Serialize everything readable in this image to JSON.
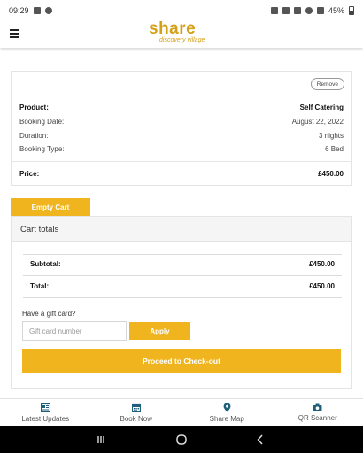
{
  "status_bar": {
    "time": "09:29",
    "battery": "45%"
  },
  "app": {
    "logo_main": "share",
    "logo_sub": "discovery village"
  },
  "cart_item": {
    "remove_label": "Remove",
    "rows": [
      {
        "label": "Product:",
        "value": "Self Catering"
      },
      {
        "label": "Booking Date:",
        "value": "August 22, 2022"
      },
      {
        "label": "Duration:",
        "value": "3 nights"
      },
      {
        "label": "Booking Type:",
        "value": "6 Bed"
      }
    ],
    "price_label": "Price:",
    "price_value": "£450.00"
  },
  "empty_cart_label": "Empty Cart",
  "totals": {
    "title": "Cart totals",
    "subtotal_label": "Subtotal:",
    "subtotal_value": "£450.00",
    "total_label": "Total:",
    "total_value": "£450.00"
  },
  "gift_card": {
    "question": "Have a gift card?",
    "placeholder": "Gift card number",
    "apply_label": "Apply"
  },
  "checkout_label": "Proceed to Check-out",
  "bottom_nav": [
    {
      "label": "Latest Updates",
      "icon": "newspaper-icon"
    },
    {
      "label": "Book Now",
      "icon": "calendar-icon"
    },
    {
      "label": "Share Map",
      "icon": "map-pin-icon"
    },
    {
      "label": "QR Scanner",
      "icon": "camera-icon"
    }
  ],
  "colors": {
    "accent": "#f0b41e",
    "brand": "#d4a017",
    "nav_active": "#1f5f7a"
  }
}
